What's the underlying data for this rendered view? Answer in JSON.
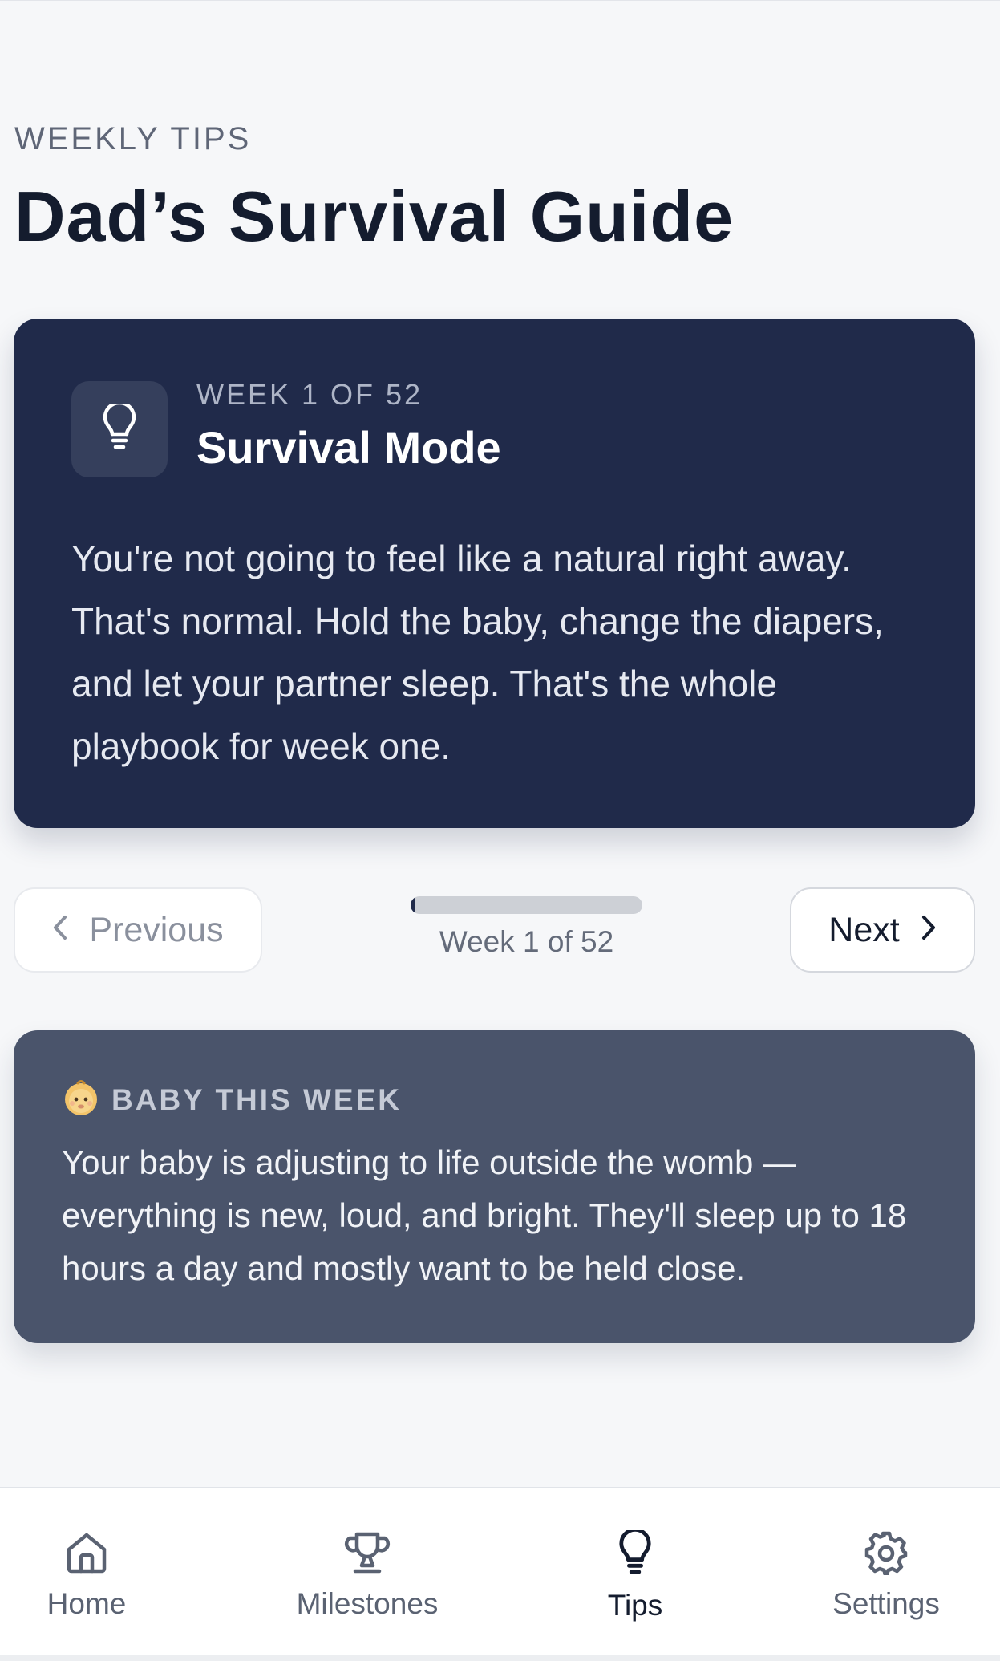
{
  "header": {
    "eyebrow": "WEEKLY TIPS",
    "title": "Dad’s Survival Guide"
  },
  "tip": {
    "icon": "lightbulb-icon",
    "week_label": "WEEK 1 OF 52",
    "title": "Survival Mode",
    "body": "You're not going to feel like a natural right away. That's normal. Hold the baby, change the diapers, and let your partner sleep. That's the whole playbook for week one."
  },
  "pager": {
    "previous_label": "Previous",
    "next_label": "Next",
    "progress_label": "Week 1 of 52",
    "current_week": 1,
    "total_weeks": 52,
    "previous_enabled": false
  },
  "baby": {
    "emoji": "👶",
    "heading": "BABY THIS WEEK",
    "body": "Your baby is adjusting to life outside the womb — everything is new, loud, and bright. They'll sleep up to 18 hours a day and mostly want to be held close."
  },
  "tabbar": {
    "items": [
      {
        "label": "Home",
        "icon": "home-icon",
        "active": false
      },
      {
        "label": "Milestones",
        "icon": "trophy-icon",
        "active": false
      },
      {
        "label": "Tips",
        "icon": "lightbulb-icon",
        "active": true
      },
      {
        "label": "Settings",
        "icon": "gear-icon",
        "active": false
      }
    ]
  },
  "colors": {
    "background": "#f6f7f9",
    "tip_card": "#202a4a",
    "baby_card": "#4a546b",
    "text_dark": "#141c2e"
  }
}
